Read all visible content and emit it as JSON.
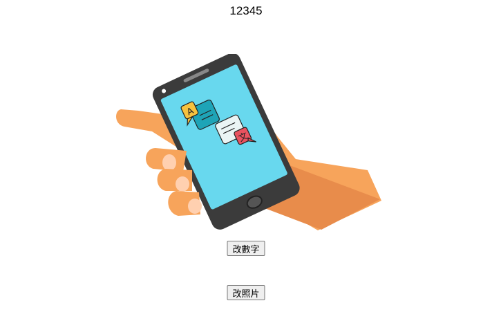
{
  "number_display": "12345",
  "illustration": {
    "icon": "translate-icon",
    "glyph_latin": "A",
    "glyph_cjk": "文",
    "colors": {
      "skin": "#f7a45b",
      "skin_shadow": "#e88c4b",
      "nail": "#ffd0b0",
      "phone": "#3b3b3b",
      "screen": "#68d8ee",
      "bubble_yellow": "#f7c23e",
      "bubble_teal": "#1ea4b7",
      "bubble_white": "#eaf4f4",
      "bubble_red": "#e8525f"
    }
  },
  "buttons": {
    "change_number": "改數字",
    "change_photo": "改照片"
  }
}
